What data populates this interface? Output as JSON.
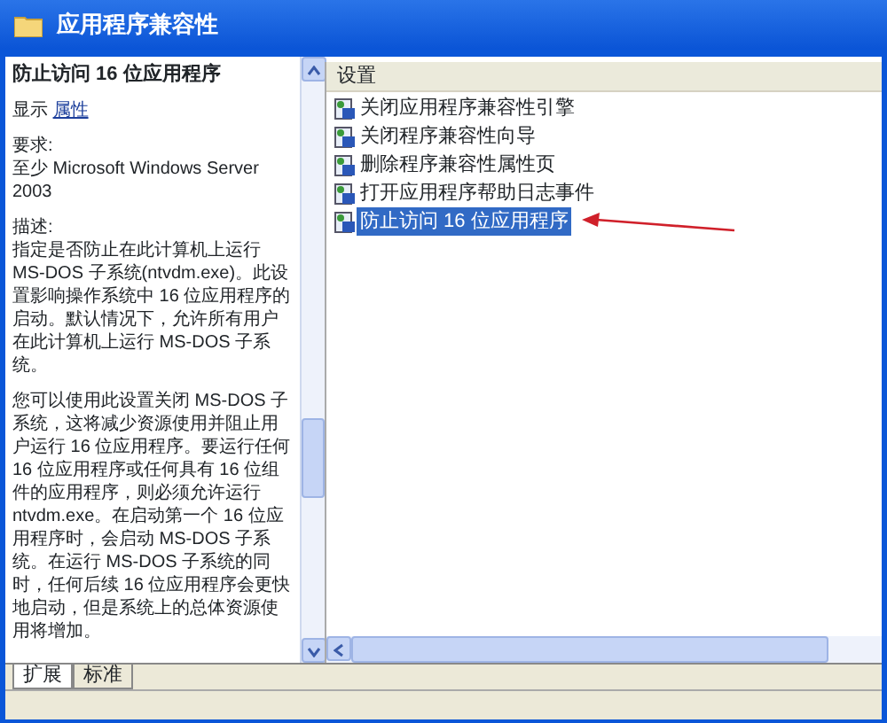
{
  "window": {
    "title": "应用程序兼容性"
  },
  "description": {
    "title": "防止访问 16 位应用程序",
    "show_label": "显示",
    "show_link": "属性",
    "requirements_label": "要求:",
    "requirements": "至少 Microsoft Windows Server 2003",
    "description_label": "描述:",
    "paragraphs": [
      "指定是否防止在此计算机上运行 MS-DOS 子系统(ntvdm.exe)。此设置影响操作系统中 16 位应用程序的启动。默认情况下，允许所有用户在此计算机上运行 MS-DOS 子系统。",
      "您可以使用此设置关闭 MS-DOS 子系统，这将减少资源使用并阻止用户运行 16 位应用程序。要运行任何 16 位应用程序或任何具有 16 位组件的应用程序，则必须允许运行 ntvdm.exe。在启动第一个 16 位应用程序时，会启动 MS-DOS 子系统。在运行 MS-DOS 子系统的同时，任何后续 16 位应用程序会更快地启动，但是系统上的总体资源使用将增加。"
    ]
  },
  "settings": {
    "column": "设置",
    "items": [
      {
        "label": "关闭应用程序兼容性引擎",
        "selected": false
      },
      {
        "label": "关闭程序兼容性向导",
        "selected": false
      },
      {
        "label": "删除程序兼容性属性页",
        "selected": false
      },
      {
        "label": "打开应用程序帮助日志事件",
        "selected": false
      },
      {
        "label": "防止访问 16 位应用程序",
        "selected": true
      }
    ]
  },
  "tabs": [
    {
      "label": "扩展",
      "selected": true
    },
    {
      "label": "标准",
      "selected": false
    }
  ]
}
